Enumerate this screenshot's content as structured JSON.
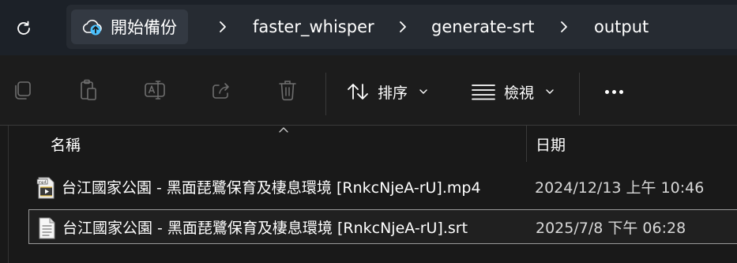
{
  "address_bar": {
    "root_label": "開始備份",
    "crumbs": [
      "faster_whisper",
      "generate-srt",
      "output"
    ]
  },
  "toolbar": {
    "sort_label": "排序",
    "view_label": "檢視"
  },
  "columns": {
    "name": "名稱",
    "date": "日期"
  },
  "files": [
    {
      "name": "台江國家公園 - 黑面琵鷺保育及棲息環境 [RnkcNjeA-rU].mp4",
      "date": "2024/12/13 上午 10:46",
      "icon": "video-file-icon",
      "selected": false
    },
    {
      "name": "台江國家公園 - 黑面琵鷺保育及棲息環境 [RnkcNjeA-rU].srt",
      "date": "2025/7/8 下午 06:28",
      "icon": "text-file-icon",
      "selected": true
    }
  ],
  "colors": {
    "accent": "#4cc2ff",
    "background": "#1c1c1c"
  }
}
